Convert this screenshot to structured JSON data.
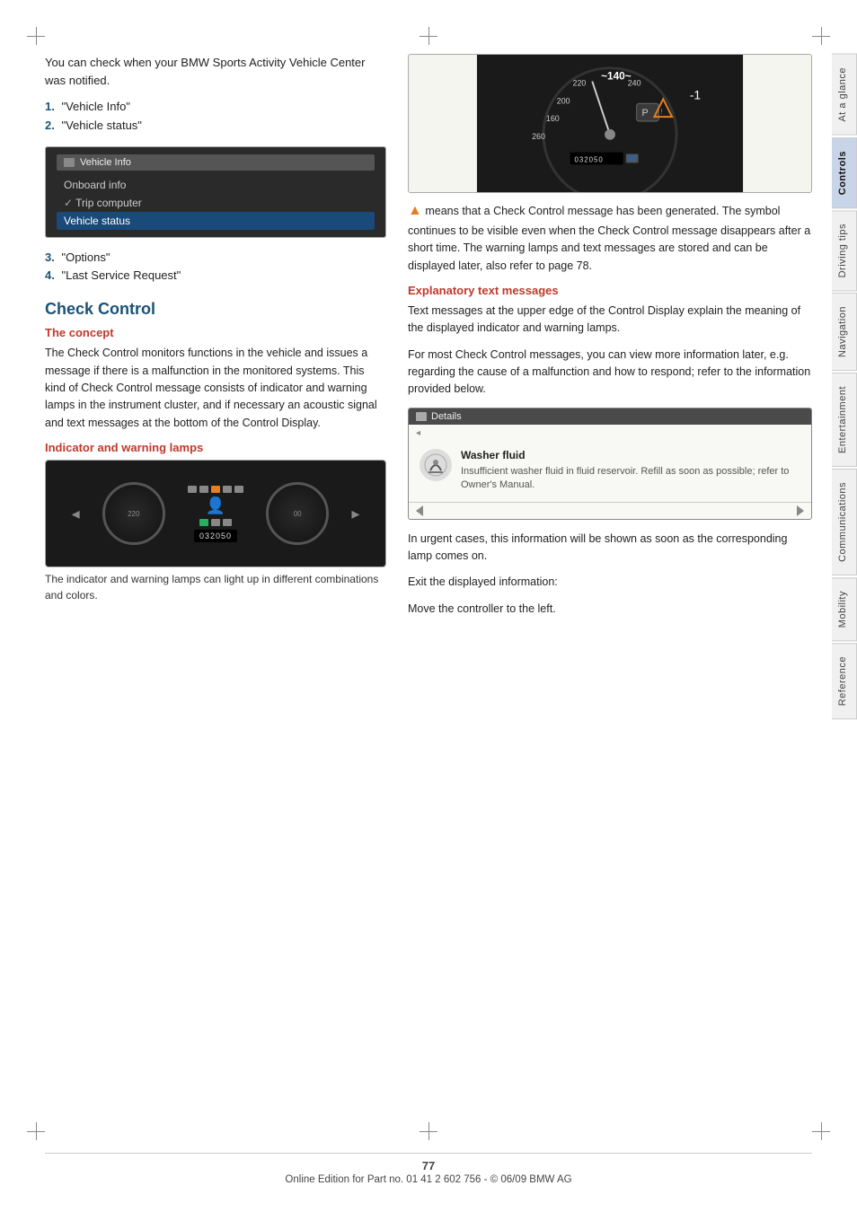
{
  "page": {
    "number": "77",
    "footer_text": "Online Edition for Part no. 01 41 2 602 756 - © 06/09 BMW AG"
  },
  "sidebar": {
    "tabs": [
      {
        "id": "at-a-glance",
        "label": "At a glance",
        "active": false
      },
      {
        "id": "controls",
        "label": "Controls",
        "active": true
      },
      {
        "id": "driving-tips",
        "label": "Driving tips",
        "active": false
      },
      {
        "id": "navigation",
        "label": "Navigation",
        "active": false
      },
      {
        "id": "entertainment",
        "label": "Entertainment",
        "active": false
      },
      {
        "id": "communications",
        "label": "Communications",
        "active": false
      },
      {
        "id": "mobility",
        "label": "Mobility",
        "active": false
      },
      {
        "id": "reference",
        "label": "Reference",
        "active": false
      }
    ]
  },
  "intro": {
    "text": "You can check when your BMW Sports Activity Vehicle Center was notified.",
    "list": [
      {
        "num": "1.",
        "text": "\"Vehicle Info\""
      },
      {
        "num": "2.",
        "text": "\"Vehicle status\""
      },
      {
        "num": "3.",
        "text": "\"Options\""
      },
      {
        "num": "4.",
        "text": "\"Last Service Request\""
      }
    ]
  },
  "vehicle_info_screen": {
    "title": "Vehicle Info",
    "items": [
      {
        "text": "Onboard info",
        "selected": false,
        "checkmark": false
      },
      {
        "text": "Trip computer",
        "selected": false,
        "checkmark": true
      },
      {
        "text": "Vehicle status",
        "selected": true,
        "checkmark": false
      }
    ]
  },
  "check_control": {
    "title": "Check Control",
    "concept": {
      "heading": "The concept",
      "text": "The Check Control monitors functions in the vehicle and issues a message if there is a malfunction in the monitored systems. This kind of Check Control message consists of indicator and warning lamps in the instrument cluster, and if necessary an acoustic signal and text messages at the bottom of the Control Display."
    },
    "indicator_lamps": {
      "heading": "Indicator and warning lamps",
      "caption": "The indicator and warning lamps can light up in different combinations and colors."
    },
    "warning_triangle_text": "means that a Check Control message has been generated. The symbol continues to be visible even when the Check Control message disappears after a short time. The warning lamps and text messages are stored and can be displayed later, also refer to page 78.",
    "explanatory": {
      "heading": "Explanatory text messages",
      "para1": "Text messages at the upper edge of the Control Display explain the meaning of the displayed indicator and warning lamps.",
      "para2": "For most Check Control messages, you can view more information later, e.g. regarding the cause of a malfunction and how to respond; refer to the information provided below."
    },
    "urgent_text": "In urgent cases, this information will be shown as soon as the corresponding lamp comes on.",
    "exit_text": "Exit the displayed information:",
    "move_text": "Move the controller to the left."
  },
  "details_screen": {
    "header": "Details",
    "item_label": "Washer fluid",
    "item_desc": "Insufficient washer fluid in fluid reservoir. Refill as soon as possible; refer to Owner's Manual."
  }
}
